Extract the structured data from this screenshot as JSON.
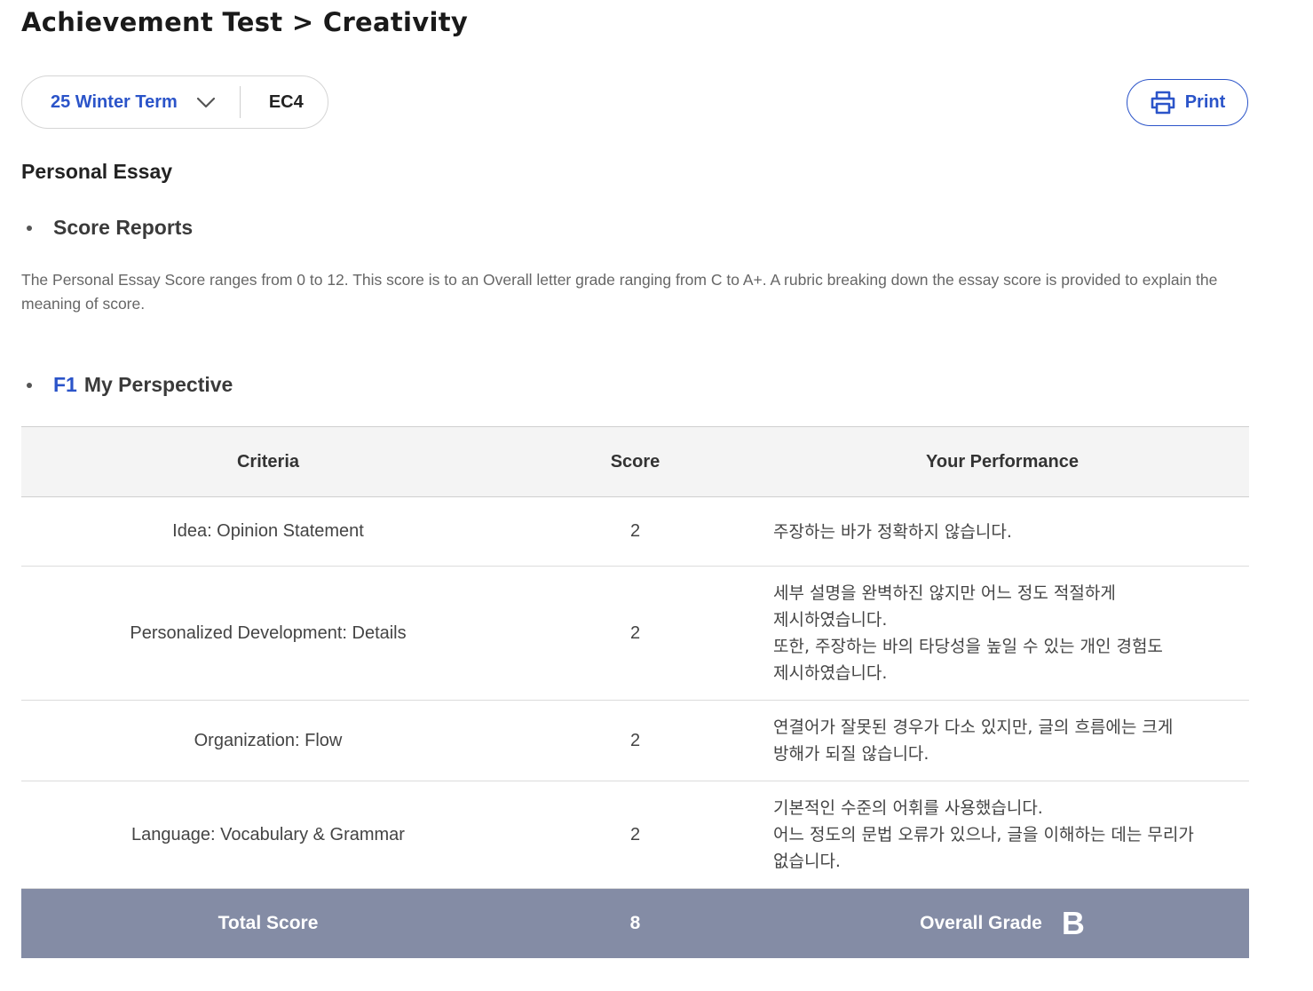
{
  "header": {
    "title": "Achievement Test > Creativity"
  },
  "filters": {
    "term": "25 Winter Term",
    "class_code": "EC4"
  },
  "toolbar": {
    "print_label": "Print"
  },
  "section": {
    "title": "Personal Essay",
    "score_reports_heading": "Score Reports",
    "description": "The Personal Essay Score ranges from 0 to 12. This score is to an Overall letter grade ranging from C to A+. A rubric breaking down the essay score is provided to explain the meaning of score.",
    "subsection": {
      "code": "F1",
      "title": "My Perspective"
    }
  },
  "table": {
    "headers": {
      "criteria": "Criteria",
      "score": "Score",
      "performance": "Your Performance"
    },
    "rows": [
      {
        "criteria": "Idea: Opinion Statement",
        "score": "2",
        "performance": [
          "주장하는 바가 정확하지 않습니다."
        ]
      },
      {
        "criteria": "Personalized Development: Details",
        "score": "2",
        "performance": [
          "세부 설명을 완벽하진 않지만 어느 정도 적절하게",
          "제시하였습니다.",
          "또한, 주장하는 바의 타당성을 높일 수 있는 개인 경험도",
          "제시하였습니다."
        ]
      },
      {
        "criteria": "Organization: Flow",
        "score": "2",
        "performance": [
          "연결어가 잘못된 경우가 다소 있지만, 글의 흐름에는 크게",
          "방해가 되질 않습니다."
        ]
      },
      {
        "criteria": "Language: Vocabulary & Grammar",
        "score": "2",
        "performance": [
          "기본적인 수준의 어휘를 사용했습니다.",
          "어느 정도의 문법 오류가 있으나, 글을 이해하는 데는 무리가",
          "없습니다."
        ]
      }
    ],
    "total": {
      "label": "Total Score",
      "score": "8",
      "grade_label": "Overall Grade",
      "grade": "B"
    }
  },
  "icons": {
    "dropdown": "chevron-down-icon",
    "print": "printer-icon"
  },
  "colors": {
    "accent": "#2b54c9",
    "total_row_bg": "#848ca5",
    "header_row_bg": "#f4f4f4"
  }
}
